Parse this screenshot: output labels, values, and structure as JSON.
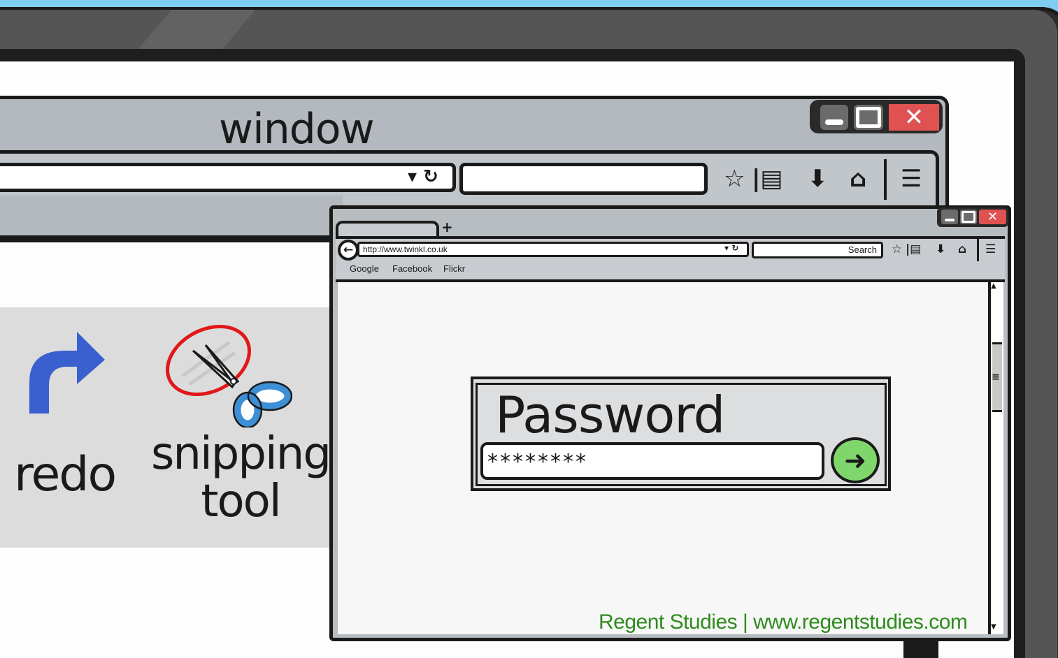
{
  "big_window": {
    "title": "window",
    "close_glyph": "✕",
    "url_controls": "▾ ↻",
    "icons": [
      "star-icon",
      "bookmark-icon",
      "download-icon",
      "home-icon",
      "menu-icon"
    ],
    "icon_glyphs": {
      "star": "☆",
      "bookmark": "|▤",
      "download": "⬇",
      "home": "⌂",
      "menu": "☰"
    }
  },
  "panel": {
    "redo_label": "redo",
    "snip_label_line1": "snipping",
    "snip_label_line2": "tool",
    "colors": {
      "redo_arrow": "#3a5fcf",
      "scissors_handle": "#3d8fd6",
      "circle": "#e01818"
    }
  },
  "browser": {
    "close_glyph": "✕",
    "new_tab_glyph": "+",
    "back_glyph": "←",
    "url": "http://www.twinkl.co.uk",
    "url_controls": "▾ ↻",
    "search_placeholder": "Search",
    "icon_glyphs": {
      "star": "☆",
      "bookmark": "|▤",
      "download": "⬇",
      "home": "⌂",
      "menu": "☰"
    },
    "bookmarks": [
      "Google",
      "Facebook",
      "Flickr"
    ],
    "scroll_up": "▲",
    "scroll_down": "▼",
    "scroll_grip": "≡"
  },
  "password": {
    "title": "Password",
    "value": "********",
    "go_glyph": "➜",
    "go_color": "#7fd66a"
  },
  "footer": {
    "credit": "Regent Studies | www.regentstudies.com"
  }
}
